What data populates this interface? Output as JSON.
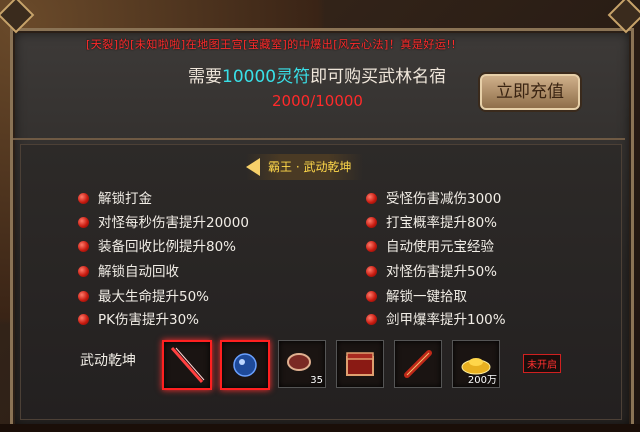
{
  "notice": "[天裂]的[未知啦啦]在地图王宫[宝藏室]的中爆出[风云心法]！真是好运!!",
  "purchase": {
    "prefix": "需要",
    "amount": "10000灵符",
    "suffix": "即可购买武林名宿",
    "progress": "2000/10000",
    "recharge_label": "立即充值"
  },
  "tab": {
    "label": "霸王 · 武动乾坤"
  },
  "attributes_left": [
    "解锁打金",
    "对怪每秒伤害提升20000",
    "装备回收比例提升80%",
    "解锁自动回收",
    "最大生命提升50%",
    "PK伤害提升30%"
  ],
  "attributes_right": [
    "受怪伤害减伤3000",
    "打宝概率提升80%",
    "自动使用元宝经验",
    "对怪伤害提升50%",
    "解锁一键拾取",
    "剑甲爆率提升100%"
  ],
  "rewards": {
    "label": "武动乾坤",
    "items": [
      {
        "icon": "sword-icon",
        "count": ""
      },
      {
        "icon": "orb-icon",
        "count": ""
      },
      {
        "icon": "gem-icon",
        "count": "35"
      },
      {
        "icon": "chest-icon",
        "count": ""
      },
      {
        "icon": "scroll-icon",
        "count": ""
      },
      {
        "icon": "gold-ingot-icon",
        "count": "200万"
      }
    ],
    "status_badge": "未开启"
  },
  "colors": {
    "highlight": "#39e0e8",
    "alert": "#ff2a2a",
    "tab_text": "#ffd84a"
  }
}
